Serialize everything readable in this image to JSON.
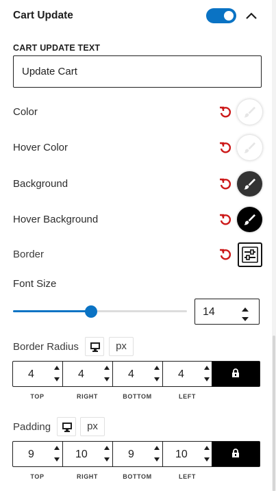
{
  "section": {
    "title": "Cart Update",
    "enabled": true
  },
  "cart_update_text": {
    "label": "CART UPDATE TEXT",
    "value": "Update Cart"
  },
  "colors": [
    {
      "label": "Color",
      "swatch": "#ffffff",
      "icon": "paintbrush-icon"
    },
    {
      "label": "Hover Color",
      "swatch": "#ffffff",
      "icon": "paintbrush-icon"
    },
    {
      "label": "Background",
      "swatch": "#333333",
      "icon": "paintbrush-icon"
    },
    {
      "label": "Hover Background",
      "swatch": "#000000",
      "icon": "paintbrush-icon"
    }
  ],
  "border": {
    "label": "Border",
    "icon": "sliders-icon"
  },
  "font_size": {
    "label": "Font Size",
    "value": "14",
    "slider_fraction": 0.45
  },
  "border_radius": {
    "label": "Border Radius",
    "unit": "px",
    "device_icon": "desktop-icon",
    "values": [
      "4",
      "4",
      "4",
      "4"
    ],
    "sides": [
      "TOP",
      "RIGHT",
      "BOTTOM",
      "LEFT"
    ],
    "lock_icon": "lock-icon"
  },
  "padding": {
    "label": "Padding",
    "unit": "px",
    "device_icon": "desktop-icon",
    "values": [
      "9",
      "10",
      "9",
      "10"
    ],
    "sides": [
      "TOP",
      "RIGHT",
      "BOTTOM",
      "LEFT"
    ],
    "lock_icon": "lock-icon"
  },
  "accent_color": "#0a73c4",
  "reset_color": "#cc1818"
}
